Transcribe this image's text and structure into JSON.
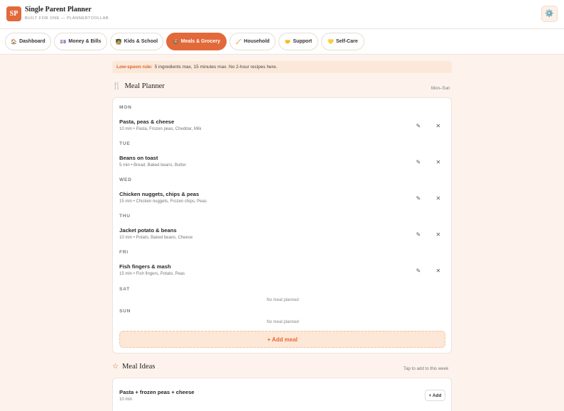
{
  "app": {
    "logo": "SP",
    "title": "Single Parent Planner",
    "subtitle": "BUILT FOR ONE — PLANNERTOOLLAB",
    "theme_icon": "gear-icon"
  },
  "nav": {
    "tabs": [
      {
        "icon": "🏠",
        "label": "Dashboard"
      },
      {
        "icon": "💷",
        "label": "Money & Bills"
      },
      {
        "icon": "🧑‍🏫",
        "label": "Kids & School"
      },
      {
        "icon": "🍲",
        "label": "Meals & Grocery"
      },
      {
        "icon": "🧹",
        "label": "Household"
      },
      {
        "icon": "🤝",
        "label": "Support"
      },
      {
        "icon": "💛",
        "label": "Self-Care"
      }
    ],
    "active_index": 3
  },
  "notice": {
    "highlight": "Low-spoon rule:",
    "text": "5 ingredients max, 15 minutes max. No 2-hour recipes here."
  },
  "meal_planner": {
    "title": "Meal Planner",
    "icon": "🍴",
    "range": "Mon–Sun",
    "days": [
      {
        "day": "MON",
        "meal": "Pasta, peas & cheese",
        "meta": "10 min • Pasta, Frozen peas, Cheddar, Milk"
      },
      {
        "day": "TUE",
        "meal": "Beans on toast",
        "meta": "5 min • Bread, Baked beans, Butter"
      },
      {
        "day": "WED",
        "meal": "Chicken nuggets, chips & peas",
        "meta": "15 min • Chicken nuggets, Frozen chips, Peas"
      },
      {
        "day": "THU",
        "meal": "Jacket potato & beans",
        "meta": "10 min • Potato, Baked beans, Cheese"
      },
      {
        "day": "FRI",
        "meal": "Fish fingers & mash",
        "meta": "15 min • Fish fingers, Potato, Peas"
      },
      {
        "day": "SAT",
        "empty": "No meal planned"
      },
      {
        "day": "SUN",
        "empty": "No meal planned"
      }
    ],
    "edit_icon": "✎",
    "delete_icon": "✕",
    "add_label": "+ Add meal"
  },
  "meal_ideas": {
    "title": "Meal Ideas",
    "icon": "☆",
    "hint": "Tap to add to this week",
    "items": [
      {
        "name": "Pasta + frozen peas + cheese",
        "meta": "10 min",
        "add_label": "+ Add"
      }
    ]
  }
}
